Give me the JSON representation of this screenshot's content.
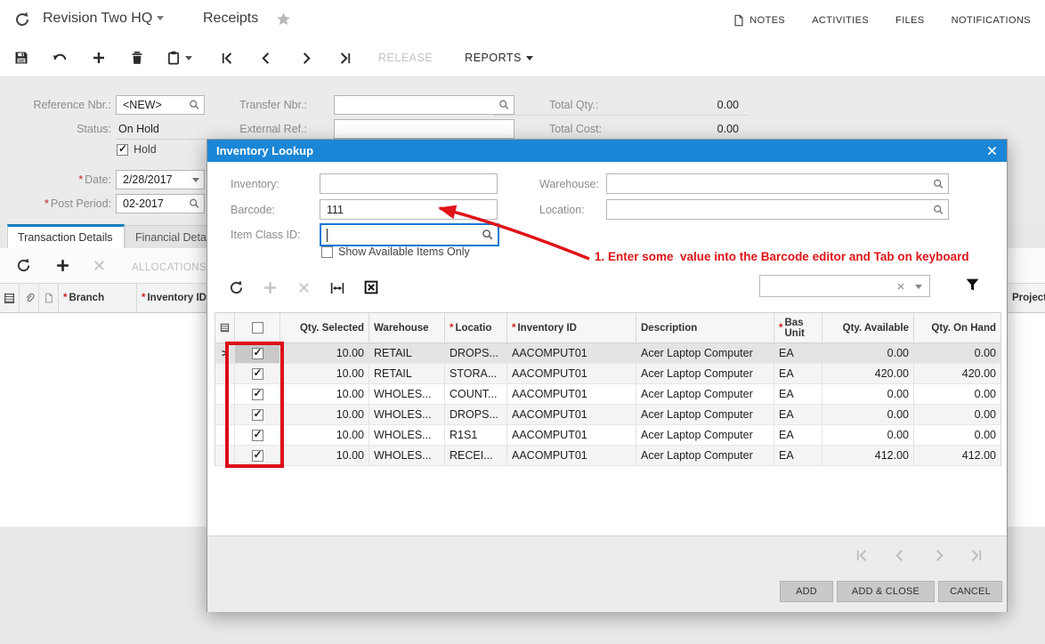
{
  "ui": {
    "required_marker": "*",
    "current_row_marker": ">"
  },
  "header": {
    "company": "Revision Two HQ",
    "page_title": "Receipts",
    "links": {
      "notes": "NOTES",
      "activities": "ACTIVITIES",
      "files": "FILES",
      "notifications": "NOTIFICATIONS"
    }
  },
  "toolbar": {
    "release": "RELEASE",
    "reports": "REPORTS"
  },
  "form": {
    "reference_label": "Reference Nbr.:",
    "reference_value": "<NEW>",
    "status_label": "Status:",
    "status_value": "On Hold",
    "hold_label": "Hold",
    "hold_checked": true,
    "date_label": "Date:",
    "date_value": "2/28/2017",
    "post_period_label": "Post Period:",
    "post_period_value": "02-2017",
    "transfer_label": "Transfer Nbr.:",
    "transfer_value": "",
    "external_label": "External Ref.:",
    "external_value": "",
    "total_qty_label": "Total Qty.:",
    "total_qty_value": "0.00",
    "total_cost_label": "Total Cost:",
    "total_cost_value": "0.00"
  },
  "tabs": {
    "transaction": "Transaction Details",
    "financial": "Financial Details"
  },
  "main_grid": {
    "allocations": "ALLOCATIONS",
    "branch_col": "Branch",
    "inventory_col": "Inventory ID",
    "project_col": "Project"
  },
  "modal": {
    "title": "Inventory Lookup",
    "fields": {
      "inventory_label": "Inventory:",
      "inventory_value": "",
      "barcode_label": "Barcode:",
      "barcode_value": "111",
      "item_class_label": "Item Class ID:",
      "item_class_value": "",
      "warehouse_label": "Warehouse:",
      "warehouse_value": "",
      "location_label": "Location:",
      "location_value": "",
      "show_available_label": "Show Available Items Only",
      "show_available_checked": false
    },
    "search_value": "",
    "grid": {
      "header_checked": false,
      "columns": {
        "qty_selected": "Qty. Selected",
        "warehouse": "Warehouse",
        "location": "Locatio",
        "inventory_id": "Inventory ID",
        "description": "Description",
        "base_unit": "Bas Unit",
        "qty_available": "Qty. Available",
        "qty_on_hand": "Qty. On Hand"
      },
      "rows": [
        {
          "checked": true,
          "qty_selected": "10.00",
          "warehouse": "RETAIL",
          "location": "DROPS...",
          "inventory_id": "AACOMPUT01",
          "description": "Acer Laptop Computer",
          "base_unit": "EA",
          "qty_available": "0.00",
          "qty_on_hand": "0.00"
        },
        {
          "checked": true,
          "qty_selected": "10.00",
          "warehouse": "RETAIL",
          "location": "STORA...",
          "inventory_id": "AACOMPUT01",
          "description": "Acer Laptop Computer",
          "base_unit": "EA",
          "qty_available": "420.00",
          "qty_on_hand": "420.00"
        },
        {
          "checked": true,
          "qty_selected": "10.00",
          "warehouse": "WHOLES...",
          "location": "COUNT...",
          "inventory_id": "AACOMPUT01",
          "description": "Acer Laptop Computer",
          "base_unit": "EA",
          "qty_available": "0.00",
          "qty_on_hand": "0.00"
        },
        {
          "checked": true,
          "qty_selected": "10.00",
          "warehouse": "WHOLES...",
          "location": "DROPS...",
          "inventory_id": "AACOMPUT01",
          "description": "Acer Laptop Computer",
          "base_unit": "EA",
          "qty_available": "0.00",
          "qty_on_hand": "0.00"
        },
        {
          "checked": true,
          "qty_selected": "10.00",
          "warehouse": "WHOLES...",
          "location": "R1S1",
          "inventory_id": "AACOMPUT01",
          "description": "Acer Laptop Computer",
          "base_unit": "EA",
          "qty_available": "0.00",
          "qty_on_hand": "0.00"
        },
        {
          "checked": true,
          "qty_selected": "10.00",
          "warehouse": "WHOLES...",
          "location": "RECEI...",
          "inventory_id": "AACOMPUT01",
          "description": "Acer Laptop Computer",
          "base_unit": "EA",
          "qty_available": "412.00",
          "qty_on_hand": "412.00"
        }
      ]
    },
    "buttons": {
      "add": "ADD",
      "add_close": "ADD & CLOSE",
      "cancel": "CANCEL"
    }
  },
  "annotation": {
    "step1": "1. Enter some  value into the Barcode editor and Tab on keyboard"
  },
  "colors": {
    "accent_blue": "#1b86d6",
    "annotation_red": "#df1418"
  }
}
